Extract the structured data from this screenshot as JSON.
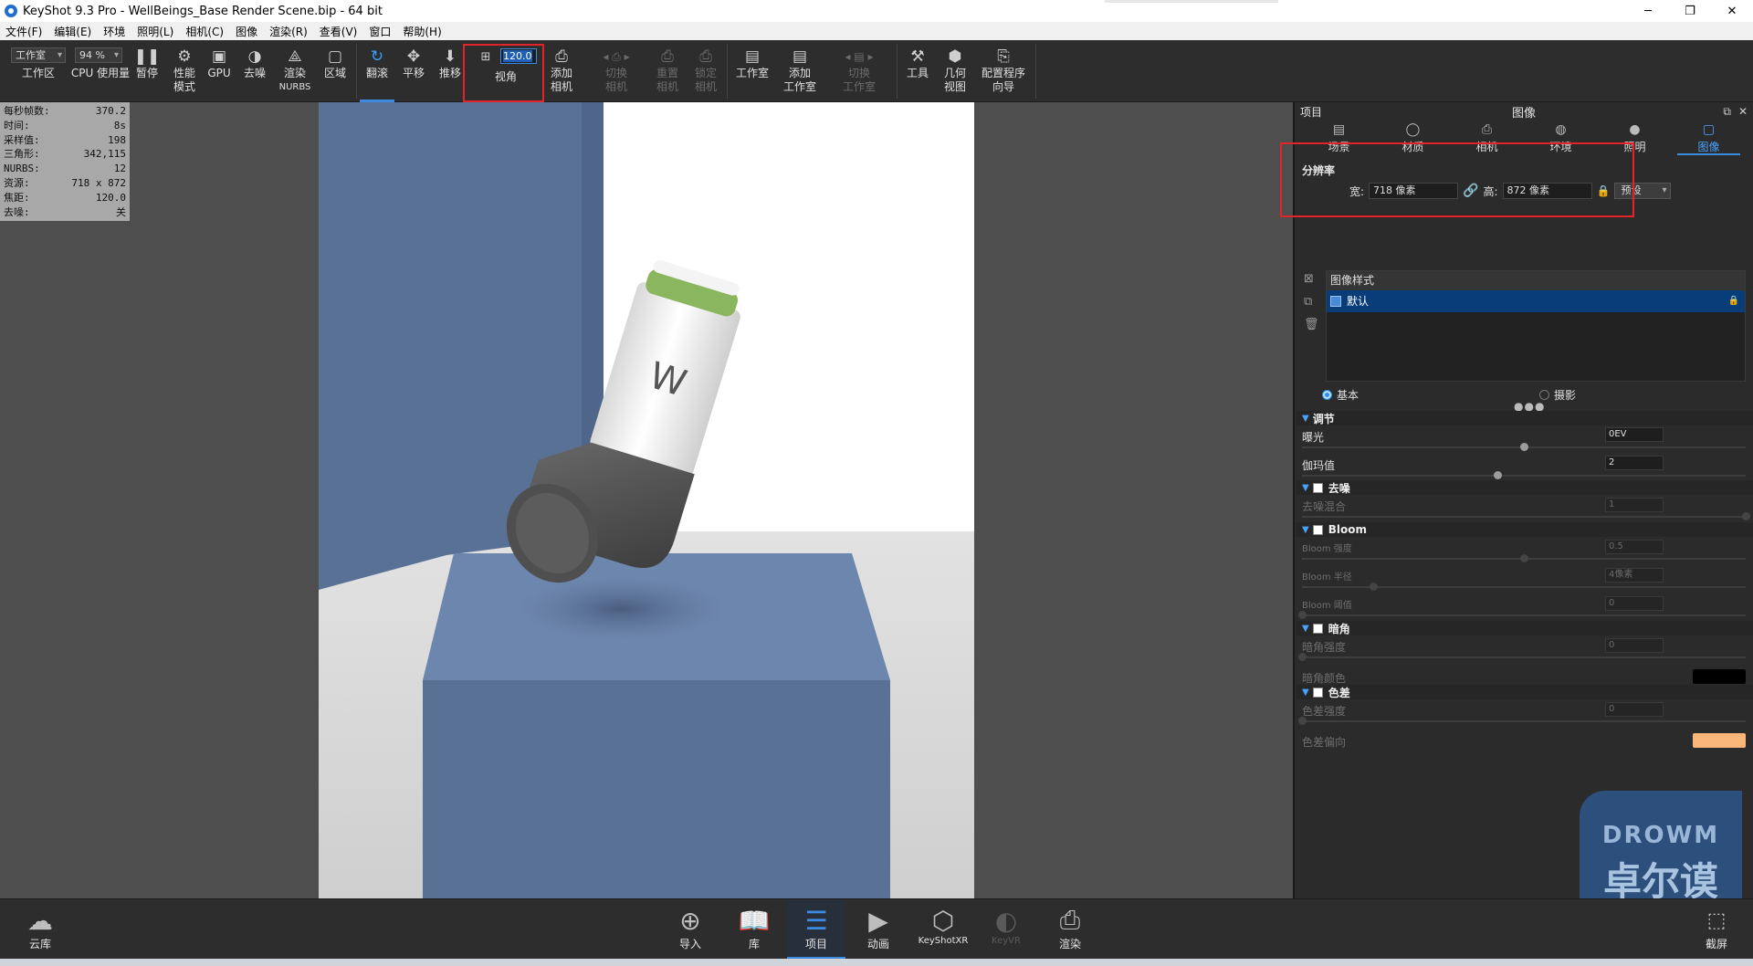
{
  "window": {
    "title": "KeyShot 9.3 Pro  - WellBeings_Base Render Scene.bip  - 64 bit",
    "buttons": [
      "─",
      "❐",
      "✕"
    ]
  },
  "menu": [
    "文件(F)",
    "编辑(E)",
    "环境",
    "照明(L)",
    "相机(C)",
    "图像",
    "渲染(R)",
    "查看(V)",
    "窗口",
    "帮助(H)"
  ],
  "toolbar": {
    "workspace_select": "工作室",
    "workspace_label": "工作区",
    "cpu_select": "94 %",
    "cpu_label": "CPU 使用量",
    "pause": "暂停",
    "perf_mode_1": "性能",
    "perf_mode_2": "模式",
    "gpu": "GPU",
    "denoise": "去噪",
    "render_nurbs_1": "渲染",
    "render_nurbs_2": "NURBS",
    "region": "区域",
    "tumble": "翻滚",
    "pan": "平移",
    "dolly": "推移",
    "fov_value": "120.0",
    "fov_label": "视角",
    "add_camera_1": "添加",
    "add_camera_2": "相机",
    "switch_camera_1": "切换",
    "switch_camera_2": "相机",
    "reset_camera_1": "重置",
    "reset_camera_2": "相机",
    "lock_camera_1": "锁定",
    "lock_camera_2": "相机",
    "studio": "工作室",
    "add_studio_1": "添加",
    "add_studio_2": "工作室",
    "switch_studio_1": "切换",
    "switch_studio_2": "工作室",
    "tools": "工具",
    "geometry_view_1": "几何",
    "geometry_view_2": "视图",
    "config_wizard_1": "配置程序",
    "config_wizard_2": "向导"
  },
  "hud": [
    {
      "k": "每秒帧数:",
      "v": "370.2"
    },
    {
      "k": "时间:",
      "v": "8s"
    },
    {
      "k": "采样值:",
      "v": "198"
    },
    {
      "k": "三角形:",
      "v": "342,115"
    },
    {
      "k": "NURBS:",
      "v": "12"
    },
    {
      "k": "资源:",
      "v": "718 x 872"
    },
    {
      "k": "焦距:",
      "v": "120.0"
    },
    {
      "k": "去噪:",
      "v": "关"
    }
  ],
  "panel": {
    "project_label": "项目",
    "title": "图像",
    "tabs": [
      {
        "label": "场景",
        "icon": "scene-icon"
      },
      {
        "label": "材质",
        "icon": "material-icon"
      },
      {
        "label": "相机",
        "icon": "camera-icon"
      },
      {
        "label": "环境",
        "icon": "environment-icon"
      },
      {
        "label": "照明",
        "icon": "lighting-icon"
      },
      {
        "label": "图像",
        "icon": "image-icon"
      }
    ],
    "resolution_label": "分辨率",
    "width_label": "宽:",
    "width_value": "718 像素",
    "height_label": "高:",
    "height_value": "872 像素",
    "preset": "预设",
    "image_style_header": "图像样式",
    "image_style_item": "默认",
    "mode_basic": "基本",
    "mode_photo": "摄影",
    "adjust_header": "调节",
    "exposure_label": "曝光",
    "exposure_value": "0EV",
    "gamma_label": "伽玛值",
    "gamma_value": "2",
    "denoise_header": "去噪",
    "denoise_blend_label": "去噪混合",
    "denoise_blend_value": "1",
    "bloom_header": "Bloom",
    "bloom_strength_label": "Bloom 强度",
    "bloom_strength_value": "0.5",
    "bloom_radius_label": "Bloom 半径",
    "bloom_radius_value": "4像素",
    "bloom_threshold_label": "Bloom 阈值",
    "bloom_threshold_value": "0",
    "vignette_header": "暗角",
    "vignette_strength_label": "暗角强度",
    "vignette_strength_value": "0",
    "vignette_color_label": "暗角颜色",
    "vignette_color": "#000000",
    "chroma_header": "色差",
    "chroma_strength_label": "色差强度",
    "chroma_strength_value": "0",
    "chroma_offset_label": "色差偏向",
    "chroma_offset_color": "#f9b67a",
    "sliders": {
      "exposure": 0.5,
      "gamma": 0.44,
      "denoise_blend": 1.0,
      "bloom_strength": 0.5,
      "bloom_radius": 0.16,
      "bloom_threshold": 0.0,
      "vignette_strength": 0.0,
      "chroma_strength": 0.0
    }
  },
  "bottombar": {
    "cloud_library": "云库",
    "import": "导入",
    "library": "库",
    "project": "项目",
    "animation": "动画",
    "keyshotxr": "KeyShotXR",
    "keyvr": "KeyVR",
    "render": "渲染",
    "screenshot": "截屏"
  },
  "watermark": {
    "line1": "DROWM",
    "line2": "卓尔谟"
  },
  "colors": {
    "accent": "#3c8be0",
    "highlight_red": "#e0242a",
    "scene_blue": "#5a7196"
  }
}
